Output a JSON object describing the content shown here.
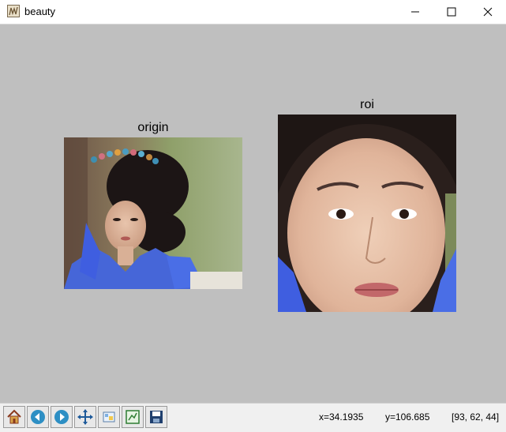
{
  "window": {
    "title": "beauty",
    "icon": "matplotlib-figure-icon",
    "controls": [
      "minimize-icon",
      "maximize-icon",
      "close-icon"
    ]
  },
  "figure": {
    "background": "#bfbfbf",
    "axes": [
      {
        "title": "origin",
        "content": "photo-full-portrait"
      },
      {
        "title": "roi",
        "content": "photo-face-crop"
      }
    ]
  },
  "toolbar": {
    "buttons": [
      "home-icon",
      "back-icon",
      "forward-icon",
      "pan-icon",
      "configure-subplots-icon",
      "zoom-rect-icon",
      "save-icon"
    ]
  },
  "status": {
    "x": "x=34.1935",
    "y": "y=106.685",
    "pixel": "[93, 62, 44]"
  }
}
